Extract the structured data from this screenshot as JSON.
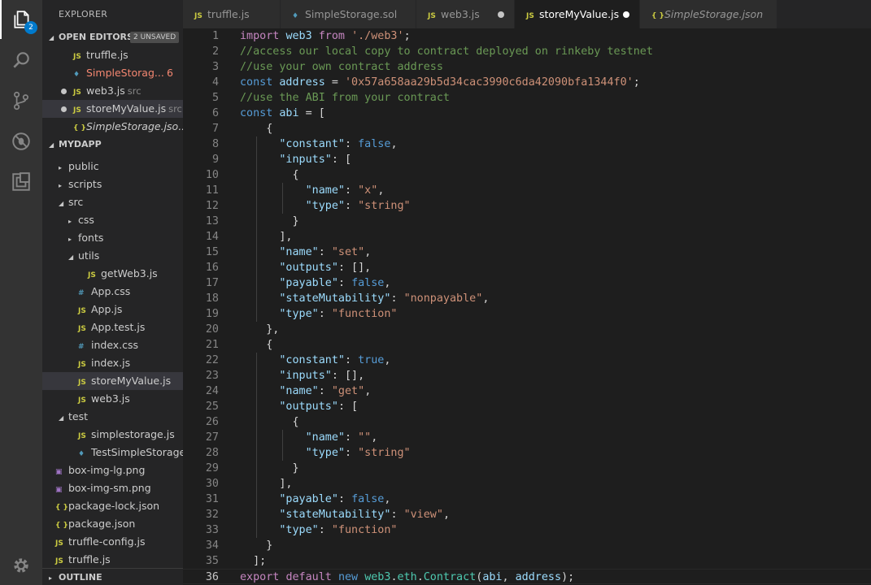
{
  "activity": {
    "explorer_badge": "2",
    "icons": [
      "files-icon",
      "search-icon",
      "source-control-icon",
      "debug-icon",
      "extensions-icon",
      "settings-gear-icon"
    ]
  },
  "sidebar": {
    "title": "EXPLORER",
    "open_editors": {
      "label": "OPEN EDITORS",
      "unsaved": "2 UNSAVED",
      "items": [
        {
          "name": "truffle.js",
          "type": "js",
          "desc": "",
          "dirty": false
        },
        {
          "name": "SimpleStorag...",
          "type": "sol",
          "desc": "",
          "dirty": false,
          "errors": "6"
        },
        {
          "name": "web3.js",
          "type": "js",
          "desc": "src",
          "dirty": true
        },
        {
          "name": "storeMyValue.js",
          "type": "js",
          "desc": "src",
          "dirty": true
        },
        {
          "name": "SimpleStorage.jso...",
          "type": "json",
          "desc": "",
          "dirty": false
        }
      ]
    },
    "project": {
      "label": "MYDAPP",
      "tree": [
        {
          "name": "public",
          "kind": "folder",
          "depth": 0,
          "open": false
        },
        {
          "name": "scripts",
          "kind": "folder",
          "depth": 0,
          "open": false
        },
        {
          "name": "src",
          "kind": "folder",
          "depth": 0,
          "open": true
        },
        {
          "name": "css",
          "kind": "folder",
          "depth": 1,
          "open": false
        },
        {
          "name": "fonts",
          "kind": "folder",
          "depth": 1,
          "open": false
        },
        {
          "name": "utils",
          "kind": "folder",
          "depth": 1,
          "open": true
        },
        {
          "name": "getWeb3.js",
          "kind": "js",
          "depth": 2
        },
        {
          "name": "App.css",
          "kind": "css",
          "depth": 1
        },
        {
          "name": "App.js",
          "kind": "js",
          "depth": 1
        },
        {
          "name": "App.test.js",
          "kind": "js",
          "depth": 1
        },
        {
          "name": "index.css",
          "kind": "css",
          "depth": 1
        },
        {
          "name": "index.js",
          "kind": "js",
          "depth": 1
        },
        {
          "name": "storeMyValue.js",
          "kind": "js",
          "depth": 1,
          "selected": true
        },
        {
          "name": "web3.js",
          "kind": "js",
          "depth": 1
        },
        {
          "name": "test",
          "kind": "folder",
          "depth": 0,
          "open": true
        },
        {
          "name": "simplestorage.js",
          "kind": "js",
          "depth": 1
        },
        {
          "name": "TestSimpleStorage....",
          "kind": "sol",
          "depth": 1
        },
        {
          "name": "box-img-lg.png",
          "kind": "png",
          "depth": 0
        },
        {
          "name": "box-img-sm.png",
          "kind": "png",
          "depth": 0
        },
        {
          "name": "package-lock.json",
          "kind": "json",
          "depth": 0
        },
        {
          "name": "package.json",
          "kind": "json",
          "depth": 0
        },
        {
          "name": "truffle-config.js",
          "kind": "js",
          "depth": 0
        },
        {
          "name": "truffle.js",
          "kind": "js",
          "depth": 0
        }
      ]
    },
    "outline_label": "OUTLINE"
  },
  "tabs": [
    {
      "name": "truffle.js",
      "type": "js",
      "width": 120,
      "active": false,
      "dirty": false,
      "italic": false
    },
    {
      "name": "SimpleStorage.sol",
      "type": "sol",
      "width": 167,
      "active": false,
      "dirty": false,
      "italic": false
    },
    {
      "name": "web3.js",
      "type": "js",
      "width": 121,
      "active": false,
      "dirty": true,
      "italic": false
    },
    {
      "name": "storeMyValue.js",
      "type": "js",
      "width": 154,
      "active": true,
      "dirty": true,
      "italic": false
    },
    {
      "name": "SimpleStorage.json",
      "type": "json",
      "width": 169,
      "active": false,
      "dirty": false,
      "italic": true
    }
  ],
  "editor": {
    "current_line": 36,
    "lines": [
      [
        [
          "kw",
          "import"
        ],
        [
          "pn",
          " "
        ],
        [
          "vr",
          "web3"
        ],
        [
          "pn",
          " "
        ],
        [
          "kw",
          "from"
        ],
        [
          "pn",
          " "
        ],
        [
          "st",
          "'./web3'"
        ],
        [
          "pn",
          ";"
        ]
      ],
      [
        [
          "cm",
          "//access our local copy to contract deployed on rinkeby testnet"
        ]
      ],
      [
        [
          "cm",
          "//use your own contract address"
        ]
      ],
      [
        [
          "bl",
          "const"
        ],
        [
          "pn",
          " "
        ],
        [
          "vr",
          "address"
        ],
        [
          "pn",
          " = "
        ],
        [
          "st",
          "'0x57a658aa29b5d34cac3990c6da42090bfa1344f0'"
        ],
        [
          "pn",
          ";"
        ]
      ],
      [
        [
          "cm",
          "//use the ABI from your contract"
        ]
      ],
      [
        [
          "bl",
          "const"
        ],
        [
          "pn",
          " "
        ],
        [
          "vr",
          "abi"
        ],
        [
          "pn",
          " = ["
        ]
      ],
      [
        [
          "pn",
          "    {"
        ]
      ],
      [
        [
          "pn",
          "      "
        ],
        [
          "vr",
          "\"constant\""
        ],
        [
          "pn",
          ": "
        ],
        [
          "bl",
          "false"
        ],
        [
          "pn",
          ","
        ]
      ],
      [
        [
          "pn",
          "      "
        ],
        [
          "vr",
          "\"inputs\""
        ],
        [
          "pn",
          ": ["
        ]
      ],
      [
        [
          "pn",
          "        {"
        ]
      ],
      [
        [
          "pn",
          "          "
        ],
        [
          "vr",
          "\"name\""
        ],
        [
          "pn",
          ": "
        ],
        [
          "st",
          "\"x\""
        ],
        [
          "pn",
          ","
        ]
      ],
      [
        [
          "pn",
          "          "
        ],
        [
          "vr",
          "\"type\""
        ],
        [
          "pn",
          ": "
        ],
        [
          "st",
          "\"string\""
        ]
      ],
      [
        [
          "pn",
          "        }"
        ]
      ],
      [
        [
          "pn",
          "      ],"
        ]
      ],
      [
        [
          "pn",
          "      "
        ],
        [
          "vr",
          "\"name\""
        ],
        [
          "pn",
          ": "
        ],
        [
          "st",
          "\"set\""
        ],
        [
          "pn",
          ","
        ]
      ],
      [
        [
          "pn",
          "      "
        ],
        [
          "vr",
          "\"outputs\""
        ],
        [
          "pn",
          ": [],"
        ]
      ],
      [
        [
          "pn",
          "      "
        ],
        [
          "vr",
          "\"payable\""
        ],
        [
          "pn",
          ": "
        ],
        [
          "bl",
          "false"
        ],
        [
          "pn",
          ","
        ]
      ],
      [
        [
          "pn",
          "      "
        ],
        [
          "vr",
          "\"stateMutability\""
        ],
        [
          "pn",
          ": "
        ],
        [
          "st",
          "\"nonpayable\""
        ],
        [
          "pn",
          ","
        ]
      ],
      [
        [
          "pn",
          "      "
        ],
        [
          "vr",
          "\"type\""
        ],
        [
          "pn",
          ": "
        ],
        [
          "st",
          "\"function\""
        ]
      ],
      [
        [
          "pn",
          "    },"
        ]
      ],
      [
        [
          "pn",
          "    {"
        ]
      ],
      [
        [
          "pn",
          "      "
        ],
        [
          "vr",
          "\"constant\""
        ],
        [
          "pn",
          ": "
        ],
        [
          "bl",
          "true"
        ],
        [
          "pn",
          ","
        ]
      ],
      [
        [
          "pn",
          "      "
        ],
        [
          "vr",
          "\"inputs\""
        ],
        [
          "pn",
          ": [],"
        ]
      ],
      [
        [
          "pn",
          "      "
        ],
        [
          "vr",
          "\"name\""
        ],
        [
          "pn",
          ": "
        ],
        [
          "st",
          "\"get\""
        ],
        [
          "pn",
          ","
        ]
      ],
      [
        [
          "pn",
          "      "
        ],
        [
          "vr",
          "\"outputs\""
        ],
        [
          "pn",
          ": ["
        ]
      ],
      [
        [
          "pn",
          "        {"
        ]
      ],
      [
        [
          "pn",
          "          "
        ],
        [
          "vr",
          "\"name\""
        ],
        [
          "pn",
          ": "
        ],
        [
          "st",
          "\"\""
        ],
        [
          "pn",
          ","
        ]
      ],
      [
        [
          "pn",
          "          "
        ],
        [
          "vr",
          "\"type\""
        ],
        [
          "pn",
          ": "
        ],
        [
          "st",
          "\"string\""
        ]
      ],
      [
        [
          "pn",
          "        }"
        ]
      ],
      [
        [
          "pn",
          "      ],"
        ]
      ],
      [
        [
          "pn",
          "      "
        ],
        [
          "vr",
          "\"payable\""
        ],
        [
          "pn",
          ": "
        ],
        [
          "bl",
          "false"
        ],
        [
          "pn",
          ","
        ]
      ],
      [
        [
          "pn",
          "      "
        ],
        [
          "vr",
          "\"stateMutability\""
        ],
        [
          "pn",
          ": "
        ],
        [
          "st",
          "\"view\""
        ],
        [
          "pn",
          ","
        ]
      ],
      [
        [
          "pn",
          "      "
        ],
        [
          "vr",
          "\"type\""
        ],
        [
          "pn",
          ": "
        ],
        [
          "st",
          "\"function\""
        ]
      ],
      [
        [
          "pn",
          "    }"
        ]
      ],
      [
        [
          "pn",
          "  ];"
        ]
      ],
      [
        [
          "kw",
          "export"
        ],
        [
          "pn",
          " "
        ],
        [
          "kw",
          "default"
        ],
        [
          "pn",
          " "
        ],
        [
          "bl",
          "new"
        ],
        [
          "pn",
          " "
        ],
        [
          "cl",
          "web3"
        ],
        [
          "pn",
          "."
        ],
        [
          "cl",
          "eth"
        ],
        [
          "pn",
          "."
        ],
        [
          "cl",
          "Contract"
        ],
        [
          "pn",
          "("
        ],
        [
          "vr",
          "abi"
        ],
        [
          "pn",
          ", "
        ],
        [
          "vr",
          "address"
        ],
        [
          "pn",
          ");"
        ]
      ]
    ]
  }
}
